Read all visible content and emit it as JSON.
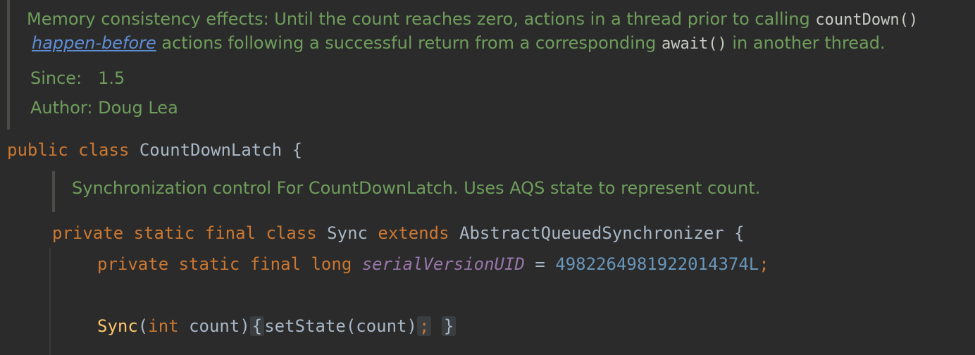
{
  "javadoc_top": {
    "line1_text": "Memory consistency effects: Until the count reaches zero, actions in a thread prior to calling ",
    "line1_code": "countDown()",
    "line2_link": "happen-before",
    "line2_text_a": " actions following a successful return from a corresponding ",
    "line2_code": "await()",
    "line2_text_b": " in another thread.",
    "since_label": "Since:",
    "since_value": "1.5",
    "author_label": "Author:",
    "author_value": "Doug Lea"
  },
  "class_decl": {
    "kw_public": "public",
    "kw_class": "class",
    "name": "CountDownLatch",
    "brace": "{"
  },
  "javadoc_inner": {
    "text": "Synchronization control For CountDownLatch. Uses AQS state to represent count."
  },
  "sync_decl": {
    "kw_private": "private",
    "kw_static": "static",
    "kw_final": "final",
    "kw_class": "class",
    "name": "Sync",
    "kw_extends": "extends",
    "super": "AbstractQueuedSynchronizer",
    "brace": "{"
  },
  "field_decl": {
    "kw_private": "private",
    "kw_static": "static",
    "kw_final": "final",
    "kw_long": "long",
    "name": "serialVersionUID",
    "eq": "=",
    "value": "4982264981922014374L",
    "semi": ";"
  },
  "ctor": {
    "name": "Sync",
    "open_paren": "(",
    "type": "int",
    "param": "count",
    "close_paren": ")",
    "fold_open": "{",
    "body": "setState(count)",
    "semi": ";",
    "fold_close": "}"
  },
  "colors": {
    "background": "#2b2b2b",
    "doc_text": "#6f9e5c",
    "keyword": "#cc7832",
    "method": "#ffc66d",
    "field": "#9876aa",
    "number": "#6897bb",
    "link": "#5f8ed6"
  }
}
